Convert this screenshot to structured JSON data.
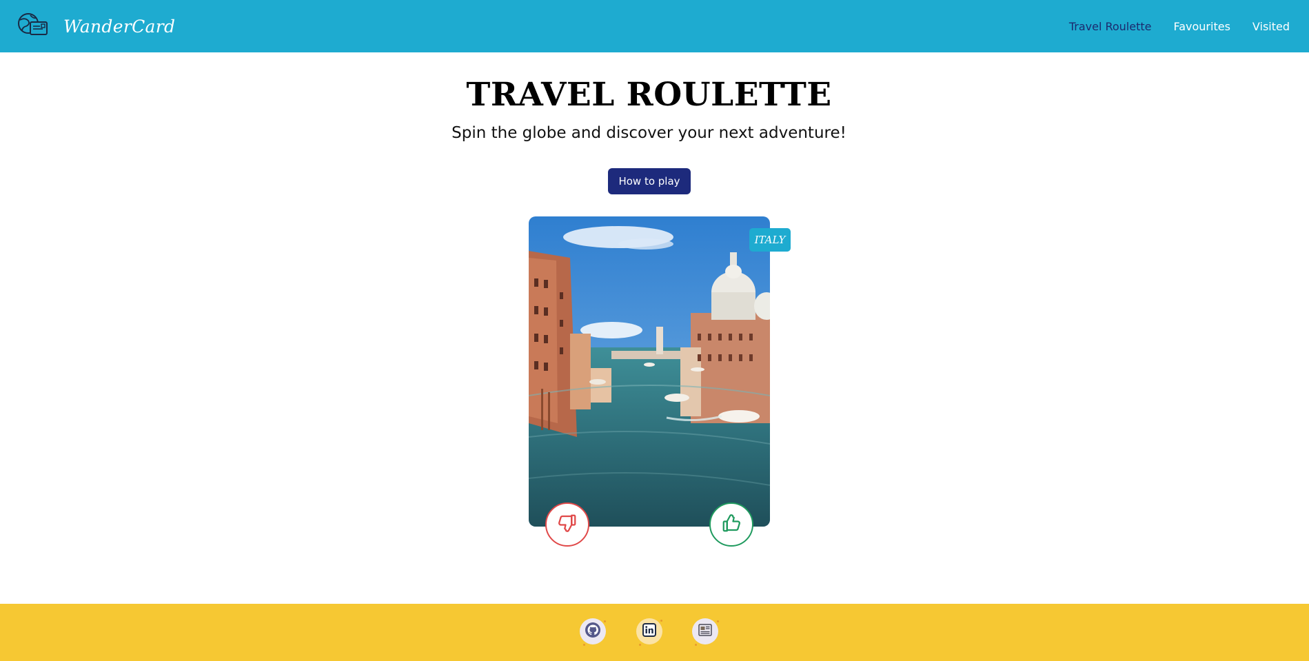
{
  "header": {
    "brand_name": "WanderCard",
    "brand_icon": "globe-postcard-icon",
    "nav": [
      {
        "label": "Travel Roulette",
        "active": true
      },
      {
        "label": "Favourites",
        "active": false
      },
      {
        "label": "Visited",
        "active": false
      }
    ]
  },
  "main": {
    "title": "TRAVEL ROULETTE",
    "subtitle": "Spin the globe and discover your next adventure!",
    "how_to_play_label": "How to play",
    "card": {
      "country": "ITALY",
      "image_description_icon": "venice-canal-photo",
      "dislike_icon": "thumbs-down-icon",
      "like_icon": "thumbs-up-icon"
    }
  },
  "footer": {
    "links": [
      {
        "icon": "github-icon"
      },
      {
        "icon": "linkedin-icon"
      },
      {
        "icon": "portfolio-icon"
      }
    ]
  },
  "colors": {
    "navbar": "#1eabd0",
    "nav_active": "#1c2a6e",
    "button": "#1d2a7c",
    "footer": "#f6c833",
    "dislike": "#e04848",
    "like": "#1f9a5e"
  }
}
